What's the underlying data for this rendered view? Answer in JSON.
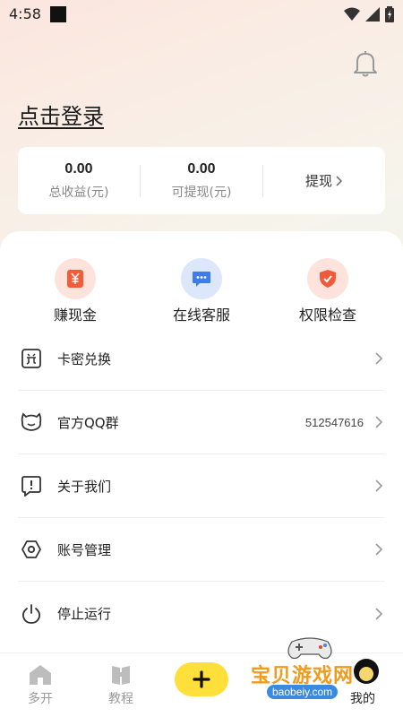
{
  "status_bar": {
    "time": "4:58"
  },
  "header": {
    "login_text": "点击登录"
  },
  "earnings": {
    "total_value": "0.00",
    "total_label": "总收益(元)",
    "withdrawable_value": "0.00",
    "withdrawable_label": "可提现(元)",
    "withdraw_label": "提现"
  },
  "quick_actions": [
    {
      "label": "赚现金",
      "icon": "yen-icon",
      "color": "#f25c3b",
      "bg": "#fde3dc"
    },
    {
      "label": "在线客服",
      "icon": "chat-icon",
      "color": "#3d7cf0",
      "bg": "#dde7fb"
    },
    {
      "label": "权限检查",
      "icon": "shield-check-icon",
      "color": "#f05a3c",
      "bg": "#fde3dc"
    }
  ],
  "menu": [
    {
      "label": "卡密兑换",
      "icon": "redeem-icon",
      "extra": ""
    },
    {
      "label": "官方QQ群",
      "icon": "qq-icon",
      "extra": "512547616"
    },
    {
      "label": "关于我们",
      "icon": "info-alert-icon",
      "extra": ""
    },
    {
      "label": "账号管理",
      "icon": "hexagon-settings-icon",
      "extra": ""
    },
    {
      "label": "停止运行",
      "icon": "power-icon",
      "extra": ""
    }
  ],
  "bottom_nav": {
    "items": [
      {
        "label": "多开",
        "icon": "home-icon"
      },
      {
        "label": "教程",
        "icon": "book-icon"
      },
      {
        "label": "我的",
        "icon": "user-icon"
      }
    ],
    "add_icon": "plus-icon",
    "accent": "#ffe03a"
  },
  "watermark": {
    "title": "宝贝游戏网",
    "site": "baobeiy.com"
  }
}
